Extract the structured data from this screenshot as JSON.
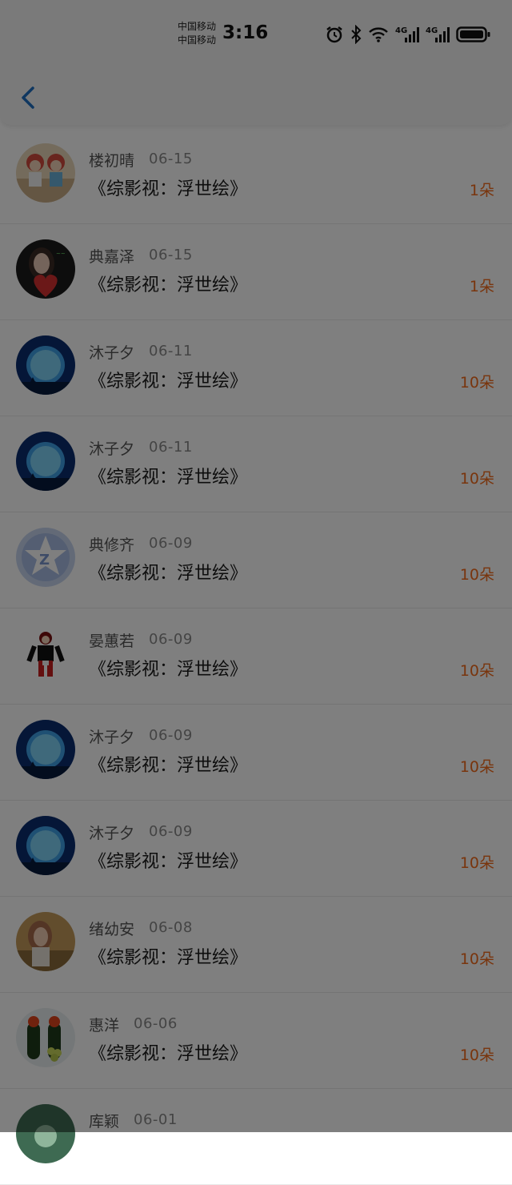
{
  "status_bar": {
    "carrier1": "中国移动",
    "carrier2": "中国移动",
    "time": "3:16",
    "net1": "4G",
    "net2": "4G",
    "icons": [
      "alarm-icon",
      "bluetooth-icon",
      "wifi-icon",
      "signal-4g-icon",
      "signal-4g-icon",
      "battery-icon"
    ]
  },
  "nav": {
    "back_icon": "chevron-left-icon",
    "accent": "#1e6fc0"
  },
  "colors": {
    "amount": "#f26a1b",
    "dim_overlay": "rgba(0,0,0,0.5)"
  },
  "records": [
    {
      "name": "楼初晴",
      "date": "06-15",
      "book": "《综影视：浮世绘》",
      "amount": "1朵",
      "avatar": "couple-photo"
    },
    {
      "name": "典嘉泽",
      "date": "06-15",
      "book": "《综影视：浮世绘》",
      "amount": "1朵",
      "avatar": "girl-heart-photo"
    },
    {
      "name": "沐子夕",
      "date": "06-11",
      "book": "《综影视：浮世绘》",
      "amount": "10朵",
      "avatar": "blue-moon"
    },
    {
      "name": "沐子夕",
      "date": "06-11",
      "book": "《综影视：浮世绘》",
      "amount": "10朵",
      "avatar": "blue-moon"
    },
    {
      "name": "典修齐",
      "date": "06-09",
      "book": "《综影视：浮世绘》",
      "amount": "10朵",
      "avatar": "qq-default"
    },
    {
      "name": "晏蕙若",
      "date": "06-09",
      "book": "《综影视：浮世绘》",
      "amount": "10朵",
      "avatar": "anime-character"
    },
    {
      "name": "沐子夕",
      "date": "06-09",
      "book": "《综影视：浮世绘》",
      "amount": "10朵",
      "avatar": "blue-moon"
    },
    {
      "name": "沐子夕",
      "date": "06-09",
      "book": "《综影视：浮世绘》",
      "amount": "10朵",
      "avatar": "blue-moon"
    },
    {
      "name": "绪幼安",
      "date": "06-08",
      "book": "《综影视：浮世绘》",
      "amount": "10朵",
      "avatar": "girl-portrait"
    },
    {
      "name": "惠洋",
      "date": "06-06",
      "book": "《综影视：浮世绘》",
      "amount": "10朵",
      "avatar": "cactus-photo"
    },
    {
      "name": "库颖",
      "date": "06-01",
      "book": "",
      "amount": "",
      "avatar": "green-photo"
    }
  ]
}
